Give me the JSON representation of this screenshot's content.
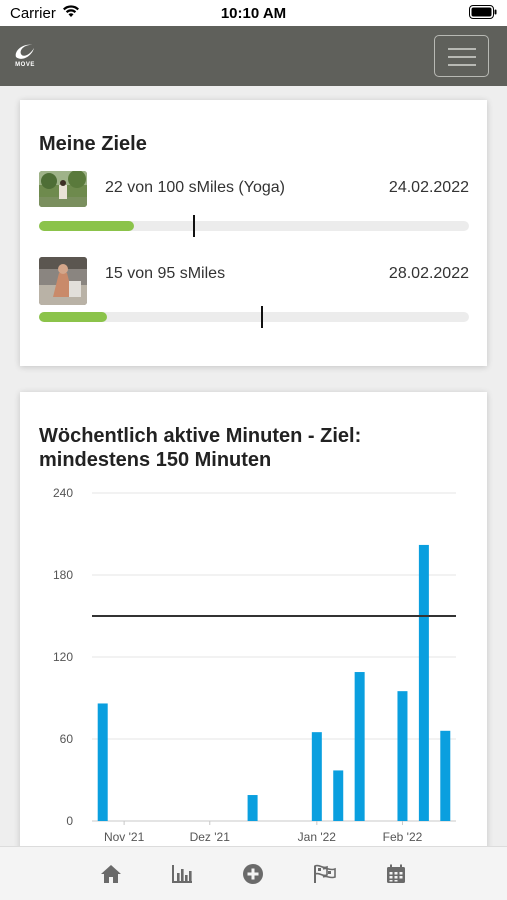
{
  "status_bar": {
    "carrier": "Carrier",
    "time": "10:10 AM"
  },
  "app": {
    "logo_text": "MOVE",
    "menu_icon": "hamburger-menu-icon"
  },
  "goals": {
    "title": "Meine Ziele",
    "items": [
      {
        "text": "22 von 100 sMiles (Yoga)",
        "date": "24.02.2022",
        "progress": 0.22,
        "time_marker": 0.36,
        "thumb": "yoga-photo"
      },
      {
        "text": "15 von 95 sMiles",
        "date": "28.02.2022",
        "progress": 0.158,
        "time_marker": 0.518,
        "thumb": "walking-photo"
      }
    ]
  },
  "chart": {
    "title_line1": "Wöchentlich aktive Minuten - Ziel:",
    "title_line2": "mindestens 150 Minuten"
  },
  "chart_data": {
    "type": "bar",
    "title": "Wöchentlich aktive Minuten - Ziel: mindestens 150 Minuten",
    "ylim": [
      0,
      240
    ],
    "yticks": [
      0,
      60,
      120,
      180,
      240
    ],
    "xticks": [
      {
        "label": "Nov '21",
        "week": 1
      },
      {
        "label": "Dez '21",
        "week": 5
      },
      {
        "label": "Jan '22",
        "week": 10
      },
      {
        "label": "Feb '22",
        "week": 14
      }
    ],
    "bars": [
      {
        "week": 0,
        "value": 86
      },
      {
        "week": 7,
        "value": 19
      },
      {
        "week": 10,
        "value": 65
      },
      {
        "week": 11,
        "value": 37
      },
      {
        "week": 12,
        "value": 109
      },
      {
        "week": 14,
        "value": 95
      },
      {
        "week": 15,
        "value": 202
      },
      {
        "week": 16,
        "value": 66
      }
    ],
    "goal_line": 150,
    "bar_color": "#0a9fdf",
    "goal_line_color": "#333333",
    "grid": true
  },
  "tabs": [
    {
      "icon": "home-icon"
    },
    {
      "icon": "bar-chart-icon"
    },
    {
      "icon": "add-circle-icon"
    },
    {
      "icon": "flags-icon"
    },
    {
      "icon": "calendar-icon"
    }
  ],
  "colors": {
    "header_bg": "#5f605b",
    "progress_fill": "#8bc34a",
    "accent_blue": "#0a9fdf"
  }
}
